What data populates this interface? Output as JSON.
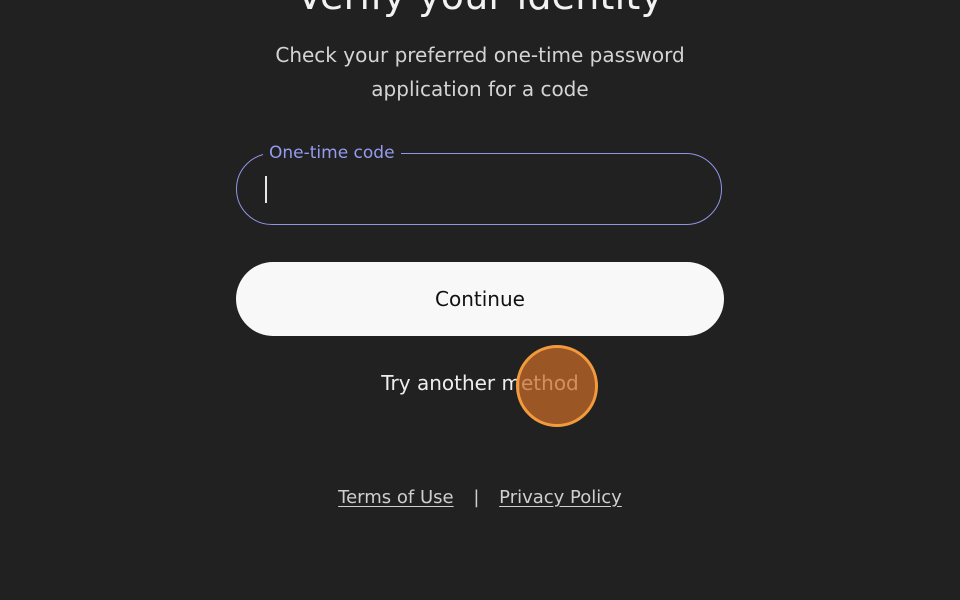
{
  "page": {
    "heading": "Verify your identity",
    "subtitle": "Check your preferred one-time password application for a code"
  },
  "otp_field": {
    "label": "One-time code",
    "value": "",
    "placeholder": ""
  },
  "actions": {
    "continue_label": "Continue",
    "alt_method_label": "Try another method"
  },
  "footer": {
    "terms_label": "Terms of Use",
    "separator": "|",
    "privacy_label": "Privacy Policy"
  },
  "colors": {
    "background": "#212121",
    "accent": "#959cf0",
    "button_bg": "#f8f8f8",
    "click_indicator": "#f39a3c"
  }
}
